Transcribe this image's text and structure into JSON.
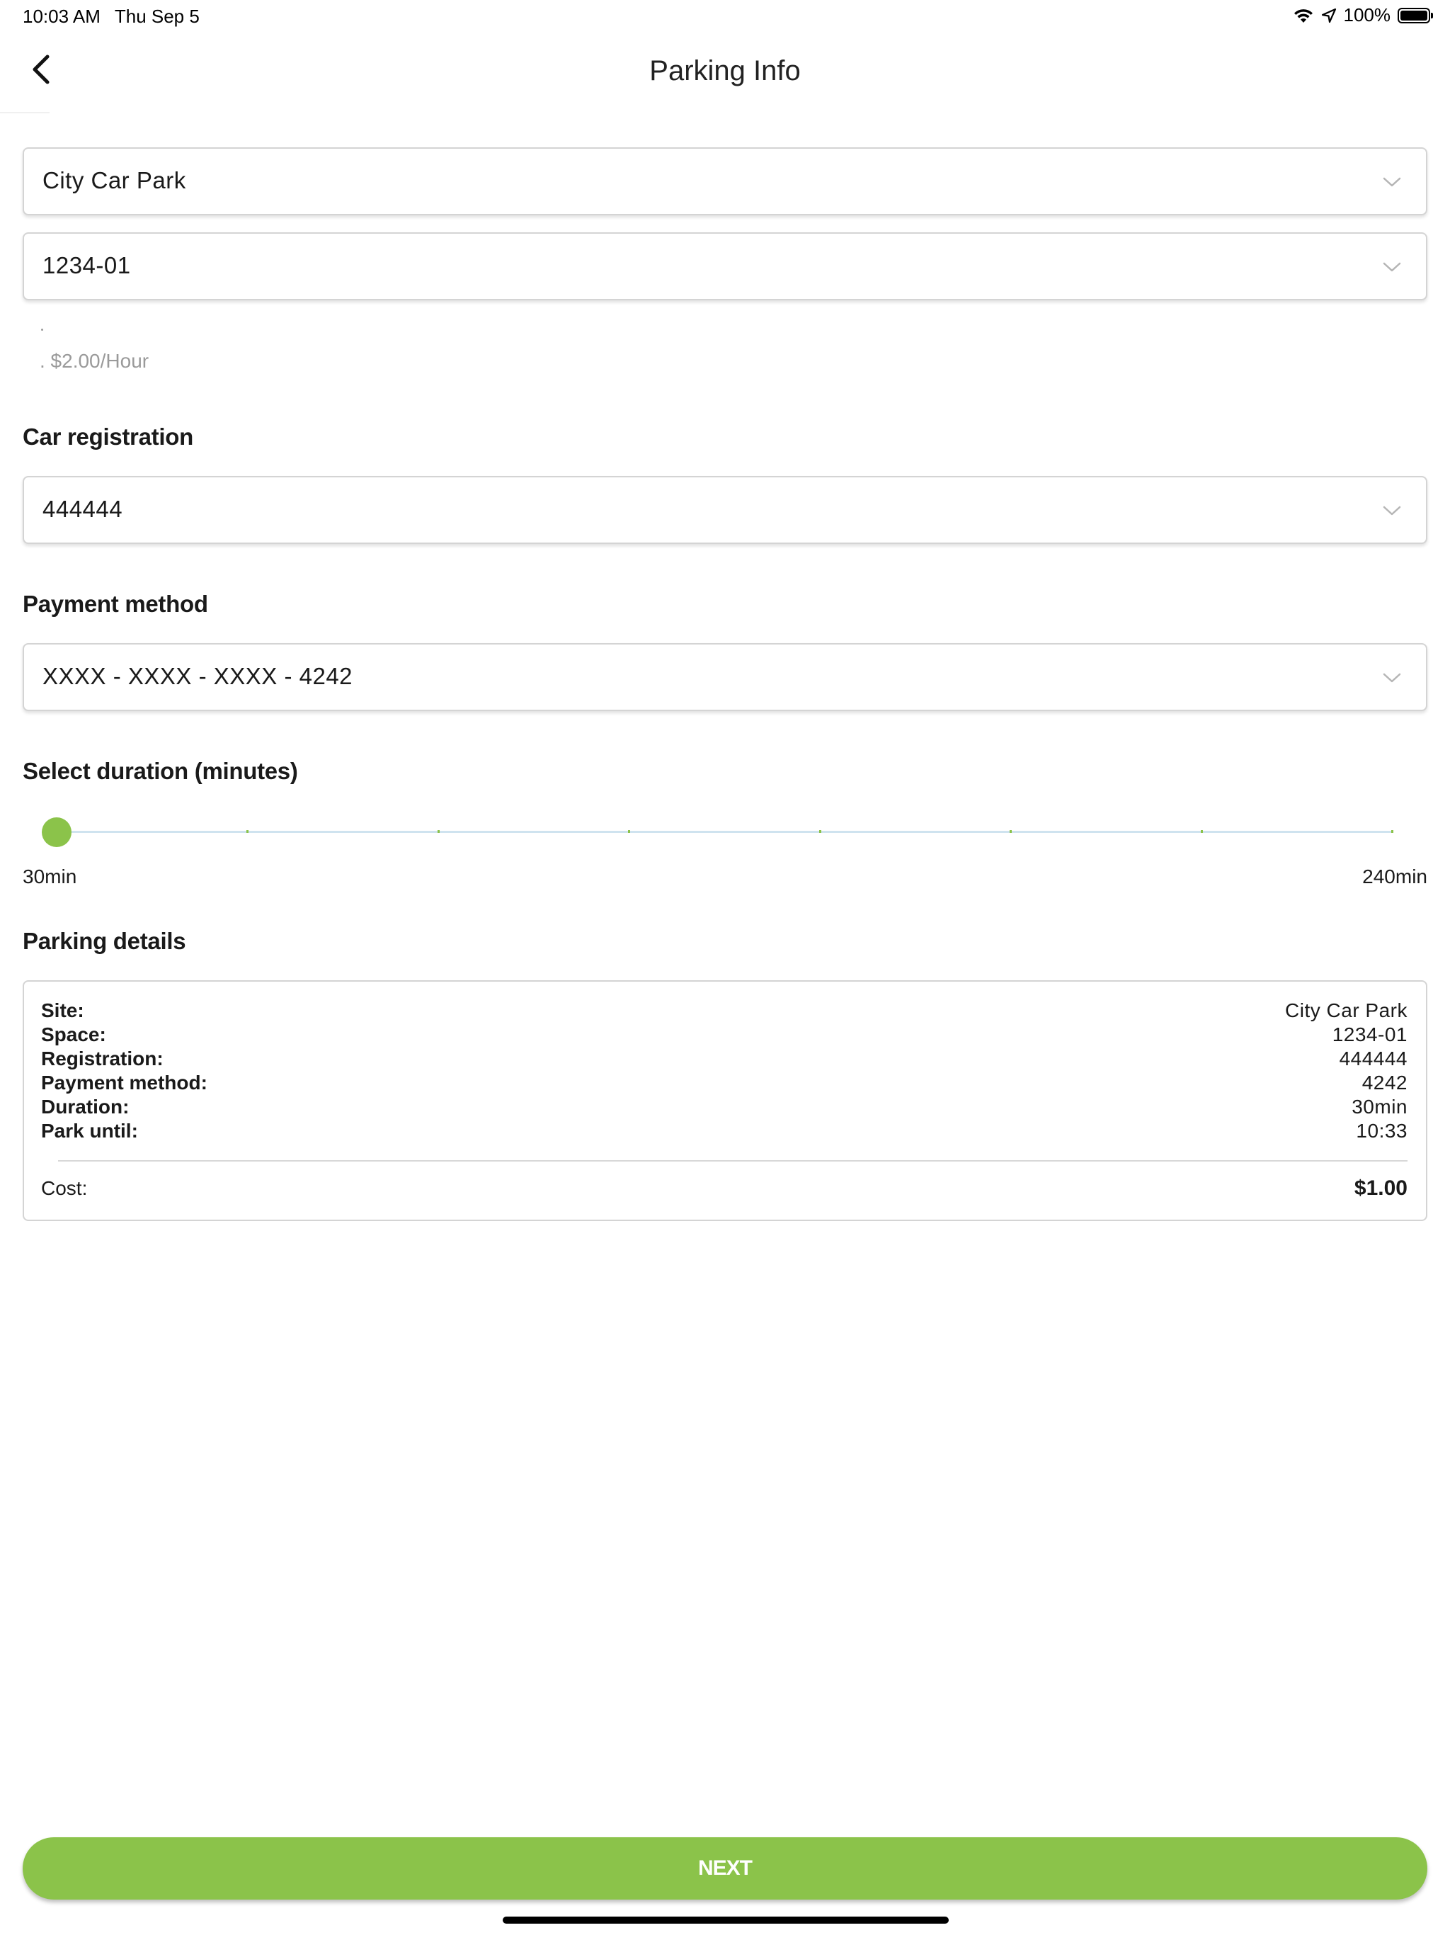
{
  "status_bar": {
    "time": "10:03 AM",
    "date": "Thu Sep 5",
    "battery": "100%",
    "icons": [
      "wifi-icon",
      "location-arrow-icon",
      "battery-icon"
    ]
  },
  "nav": {
    "title": "Parking Info",
    "back_icon": "chevron-left-icon"
  },
  "site_select": {
    "value": "City Car Park"
  },
  "space_select": {
    "value": "1234-01"
  },
  "rate": {
    "text": ". $2.00/Hour"
  },
  "registration": {
    "label": "Car registration",
    "value": "444444"
  },
  "payment": {
    "label": "Payment method",
    "value": "XXXX - XXXX - XXXX - 4242"
  },
  "duration": {
    "label": "Select duration (minutes)",
    "min_label": "30min",
    "max_label": "240min",
    "min": 30,
    "max": 240,
    "step": 30,
    "value": 30
  },
  "details": {
    "label": "Parking details",
    "rows": [
      {
        "label": "Site:",
        "value": "City Car Park"
      },
      {
        "label": "Space:",
        "value": "1234-01"
      },
      {
        "label": "Registration:",
        "value": "444444"
      },
      {
        "label": "Payment method:",
        "value": "4242"
      },
      {
        "label": "Duration:",
        "value": "30min"
      },
      {
        "label": "Park until:",
        "value": "10:33"
      }
    ],
    "cost_label": "Cost:",
    "cost_value": "$1.00"
  },
  "next_button": {
    "label": "NEXT"
  },
  "colors": {
    "accent": "#8bc34a",
    "border": "#d4d4d4",
    "track": "#cfe3ef"
  }
}
